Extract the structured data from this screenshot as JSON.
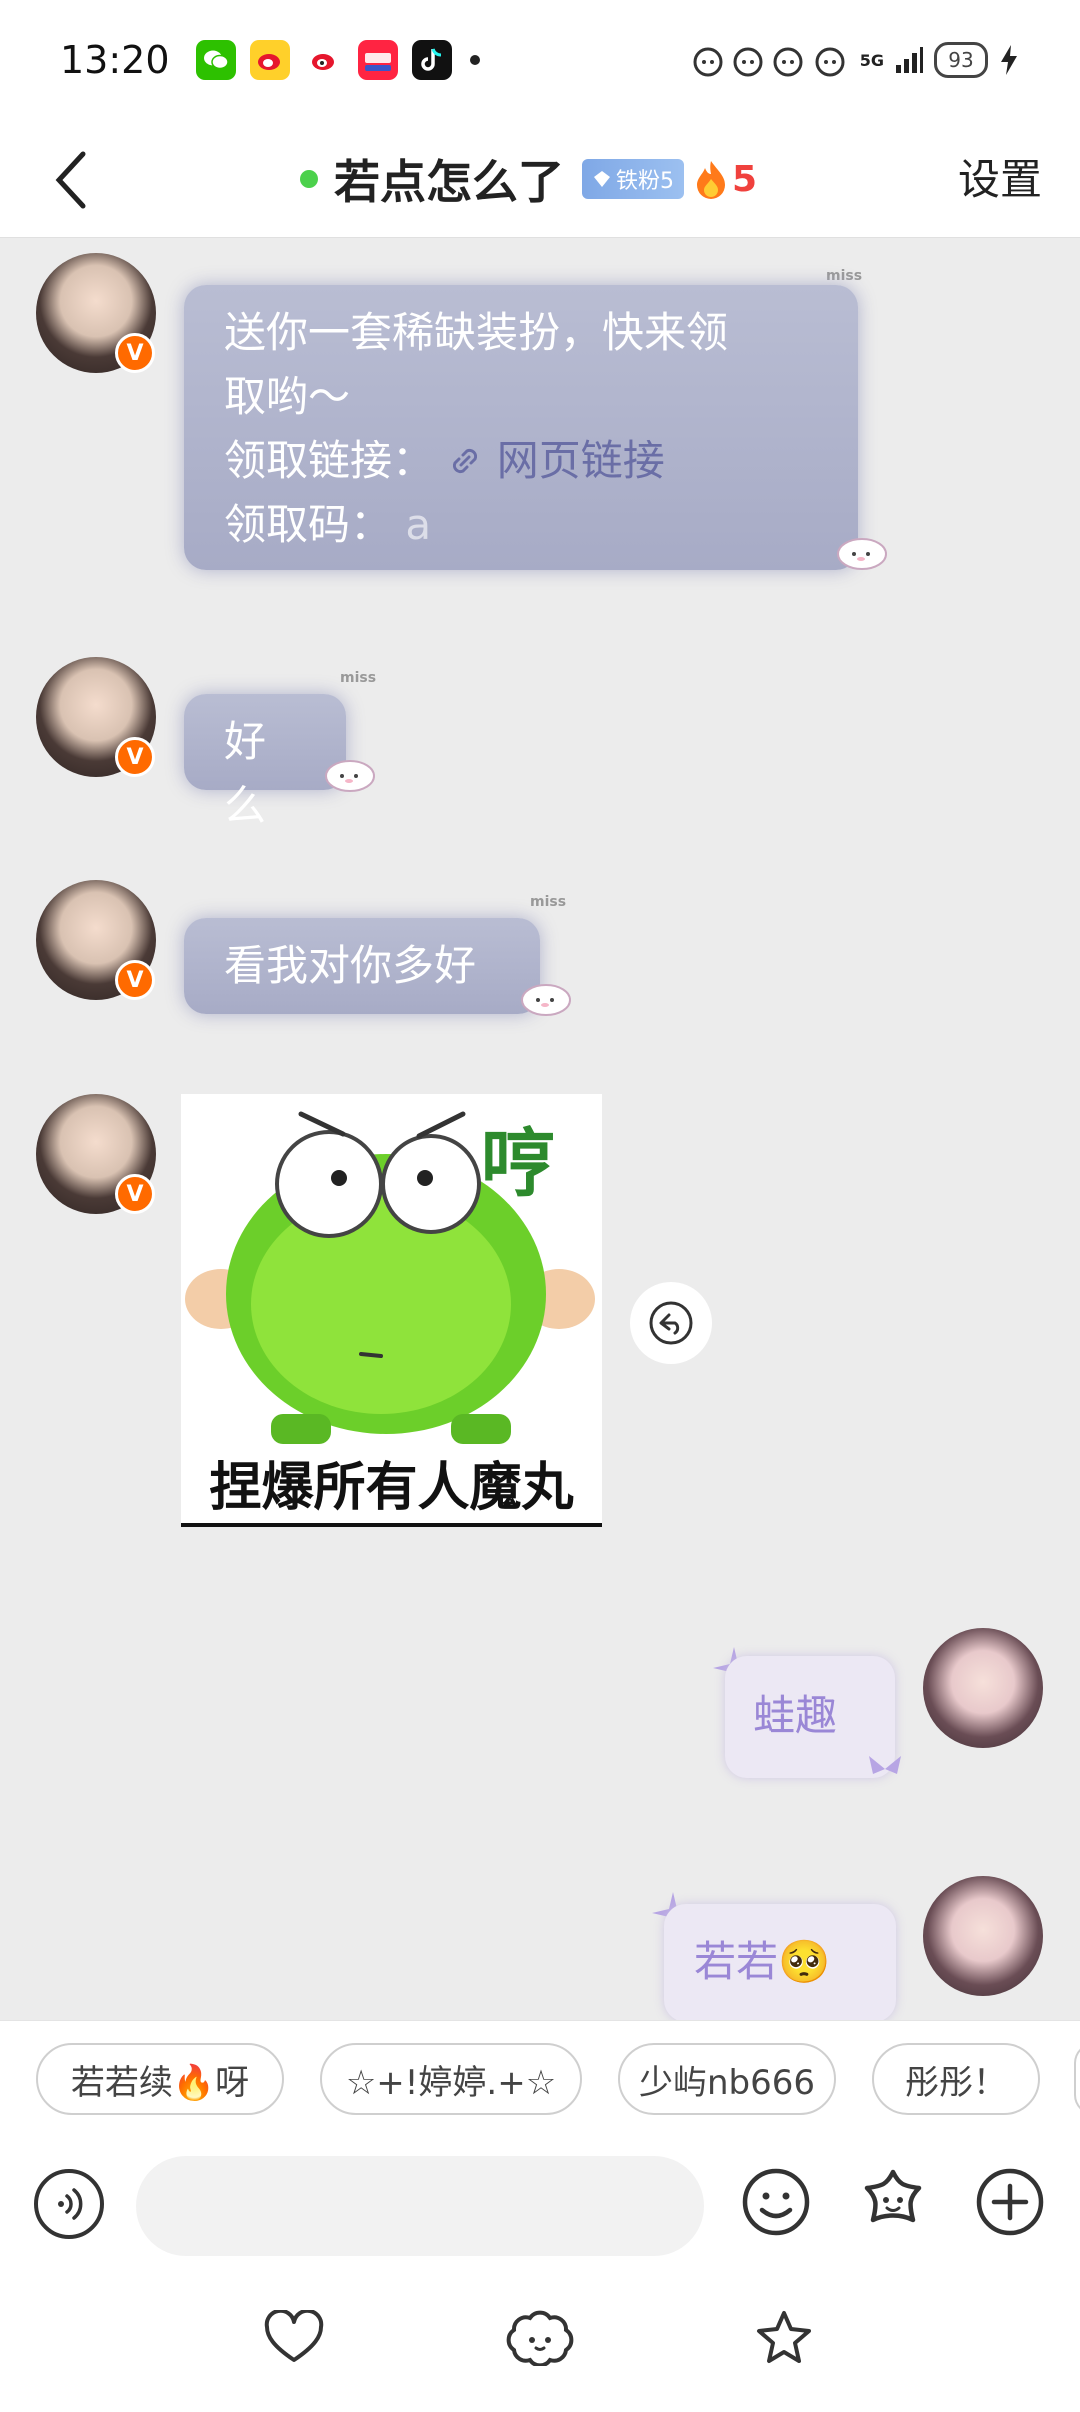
{
  "status_bar": {
    "time": "13:20",
    "network": "5G",
    "battery": "93",
    "apps": [
      "wechat-icon",
      "weibo-icon",
      "weibo-alt-icon",
      "xiaohongshu-icon",
      "douyin-icon"
    ]
  },
  "header": {
    "title": "若点怎么了",
    "fan_badge": "铁粉5",
    "streak_count": "5",
    "settings_label": "设置",
    "online_color": "#4cd14c"
  },
  "messages": {
    "m1": {
      "line1": "送你一套稀缺装扮，快来领",
      "line2": "取哟～",
      "line3_label": "领取链接：",
      "link_text": "网页链接",
      "line4_label": "领取码：",
      "line4_partial": "a"
    },
    "m2": {
      "text": "好么"
    },
    "m3": {
      "text": "看我对你多好"
    },
    "m4": {
      "caption": "捏爆所有人魔丸",
      "sticker_char": "哼"
    },
    "m5": {
      "text": "蛙趣"
    },
    "m6": {
      "text": "若若",
      "emoji": "🥺"
    },
    "miss_label": "miss"
  },
  "quick_replies": [
    "若若续🔥呀",
    "☆+!婷婷.+☆",
    "少屿nb666",
    "彤彤！"
  ],
  "input": {
    "placeholder": ""
  },
  "colors": {
    "incoming_bubble": "#aeb2cb",
    "outgoing_text": "#9a87d6",
    "v_badge": "#ff6a00",
    "streak": "#f0413d"
  }
}
